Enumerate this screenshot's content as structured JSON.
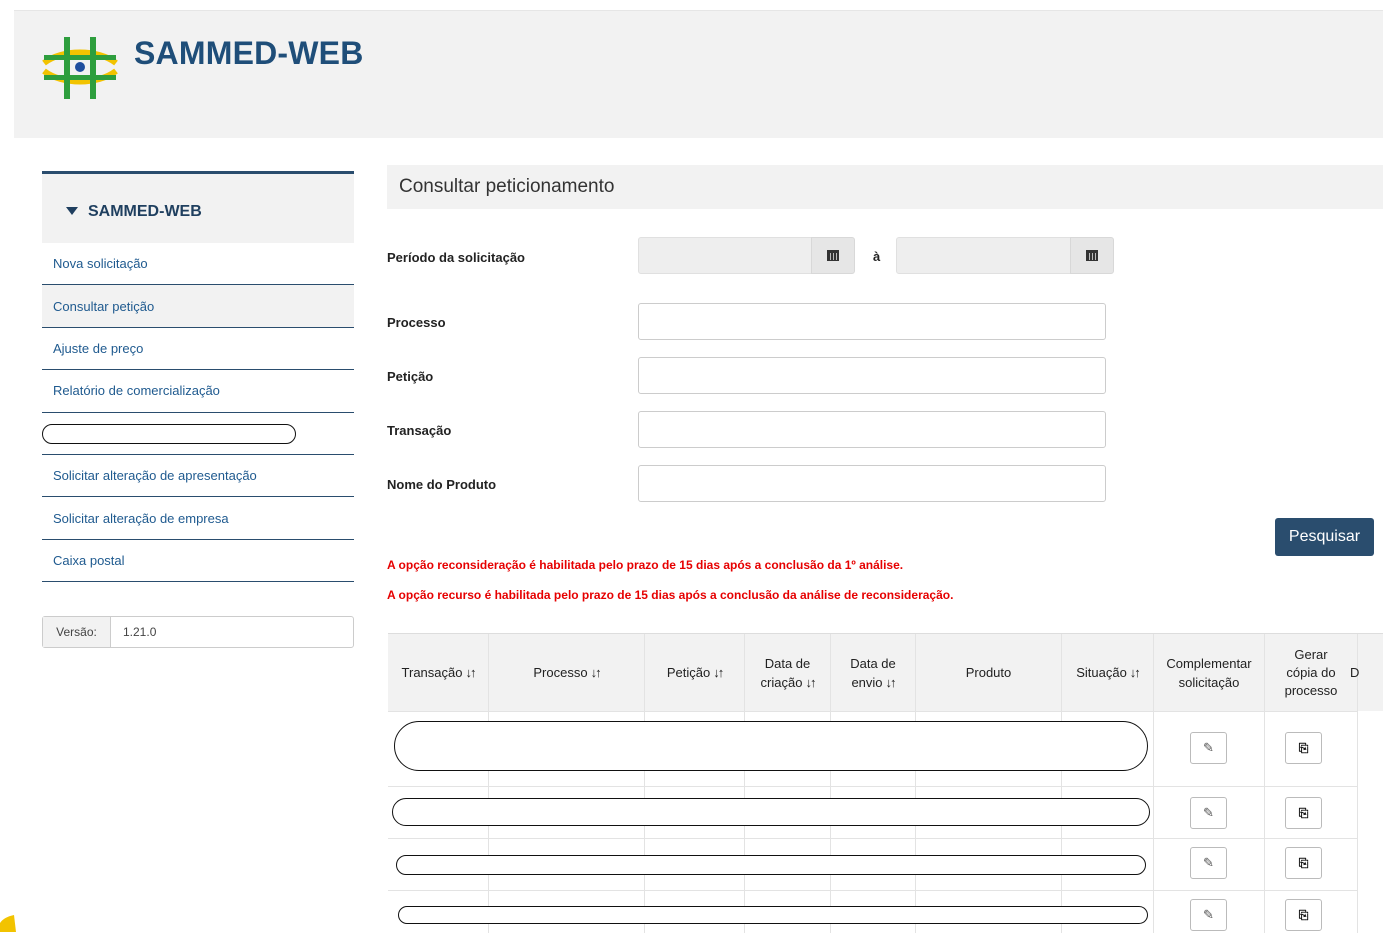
{
  "header": {
    "title": "SAMMED-WEB"
  },
  "sidebar": {
    "title": "SAMMED-WEB",
    "items": [
      {
        "label": "Nova solicitação",
        "active": false
      },
      {
        "label": "Consultar petição",
        "active": true
      },
      {
        "label": "Ajuste de preço",
        "active": false
      },
      {
        "label": "Relatório de comercialização",
        "active": false
      },
      {
        "label": "",
        "redacted": true
      },
      {
        "label": "Solicitar alteração de apresentação",
        "active": false
      },
      {
        "label": "Solicitar alteração de empresa",
        "active": false
      },
      {
        "label": "Caixa postal",
        "active": false
      }
    ],
    "version_label": "Versão:",
    "version_value": "1.21.0"
  },
  "main": {
    "title": "Consultar peticionamento",
    "filters": {
      "periodo_label": "Período da solicitação",
      "periodo_sep": "à",
      "processo_label": "Processo",
      "peticao_label": "Petição",
      "transacao_label": "Transação",
      "produto_label": "Nome do Produto"
    },
    "search_button": "Pesquisar",
    "notices": [
      "A opção reconsideração é habilitada pelo prazo de 15 dias após a conclusão da 1º análise.",
      "A opção recurso é habilitada pelo prazo de 15 dias após a conclusão da análise de reconsideração."
    ],
    "table": {
      "sort_glyph": "↓↑",
      "columns": [
        {
          "line1": "Transação",
          "sortable": true
        },
        {
          "line1": "Processo",
          "sortable": true
        },
        {
          "line1": "Petição",
          "sortable": true
        },
        {
          "line1": "Data de",
          "line2": "criação",
          "sortable": true
        },
        {
          "line1": "Data de",
          "line2": "envio",
          "sortable": true
        },
        {
          "line1": "Produto",
          "sortable": false
        },
        {
          "line1": "Situação",
          "sortable": true
        },
        {
          "line1": "Complementar",
          "line2": "solicitação",
          "sortable": false
        },
        {
          "line1": "Gerar",
          "line2": "cópia do",
          "line3": "processo",
          "sortable": false
        },
        {
          "line1": "D",
          "sortable": false
        }
      ],
      "rows": 4
    }
  },
  "colors": {
    "accent": "#2a4d6e",
    "title_blue": "#1f4e79",
    "link_blue": "#1f5a8f",
    "notice_red": "#e60000",
    "panel_gray": "#f2f2f2"
  },
  "icons": [
    "logo-cross-icon",
    "caret-down-icon",
    "calendar-icon",
    "pencil-icon",
    "copy-document-icon"
  ]
}
